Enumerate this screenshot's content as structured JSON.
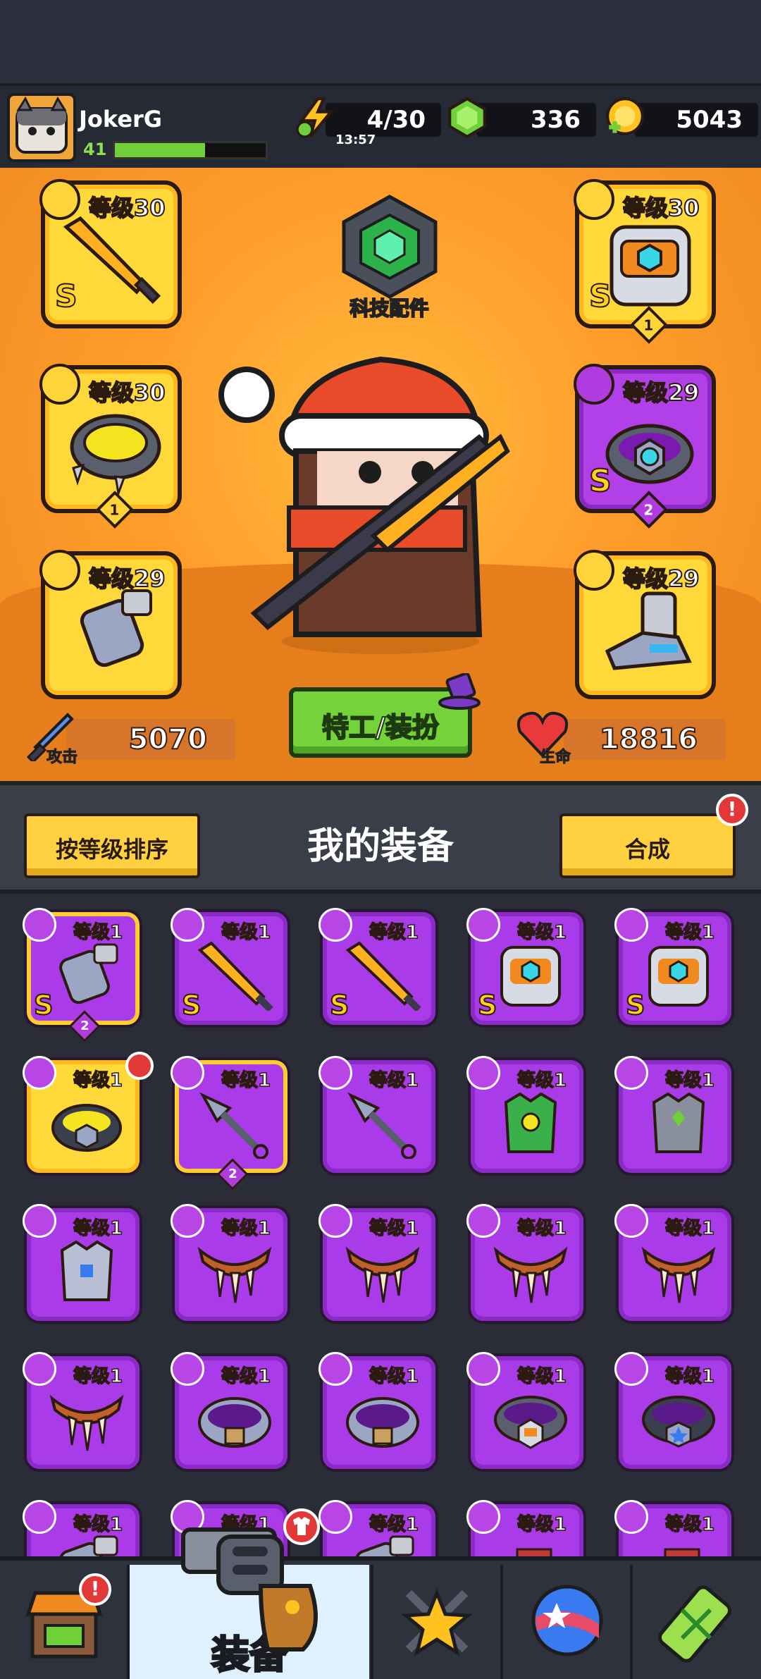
{
  "player": {
    "name": "JokerG",
    "level": "41",
    "xp_fraction": 0.6
  },
  "resources": [
    {
      "name": "energy",
      "icon": "lightning-icon",
      "value": "4/30",
      "sub": "13:57"
    },
    {
      "name": "gems",
      "icon": "green-gem-icon",
      "value": "336",
      "sub": ""
    },
    {
      "name": "coins",
      "icon": "gold-coin-icon",
      "value": "5043",
      "sub": ""
    }
  ],
  "tech": {
    "label": "科技配件"
  },
  "slots": {
    "weapon": {
      "level": "等级30",
      "rank": "S",
      "stars": ""
    },
    "armor": {
      "level": "等级30",
      "rank": "S",
      "stars": "1"
    },
    "necklace": {
      "level": "等级30",
      "rank": "",
      "stars": "1"
    },
    "belt": {
      "level": "等级29",
      "rank": "S",
      "stars": "2"
    },
    "gloves": {
      "level": "等级29",
      "rank": "",
      "stars": ""
    },
    "boots": {
      "level": "等级29",
      "rank": "",
      "stars": ""
    }
  },
  "stats": {
    "attack": {
      "label": "攻击",
      "value": "5070"
    },
    "health": {
      "label": "生命",
      "value": "18816"
    }
  },
  "agent_button": "特工/装扮",
  "section": {
    "sort_label": "按等级排序",
    "title": "我的装备",
    "merge_label": "合成",
    "merge_alert": "!"
  },
  "inventory": [
    {
      "level": "等级1",
      "rank": "S",
      "stars": "2",
      "kind": "gloves"
    },
    {
      "level": "等级1",
      "rank": "S",
      "stars": "",
      "kind": "sword"
    },
    {
      "level": "等级1",
      "rank": "S",
      "stars": "",
      "kind": "sword"
    },
    {
      "level": "等级1",
      "rank": "S",
      "stars": "",
      "kind": "armor"
    },
    {
      "level": "等级1",
      "rank": "S",
      "stars": "",
      "kind": "armor"
    },
    {
      "level": "等级1",
      "rank": "",
      "stars": "",
      "kind": "belt-gold"
    },
    {
      "level": "等级1",
      "rank": "",
      "stars": "2",
      "kind": "kunai"
    },
    {
      "level": "等级1",
      "rank": "",
      "stars": "",
      "kind": "kunai"
    },
    {
      "level": "等级1",
      "rank": "",
      "stars": "",
      "kind": "vest-green"
    },
    {
      "level": "等级1",
      "rank": "",
      "stars": "",
      "kind": "vest-grey"
    },
    {
      "level": "等级1",
      "rank": "",
      "stars": "",
      "kind": "vest-blue"
    },
    {
      "level": "等级1",
      "rank": "",
      "stars": "",
      "kind": "fang"
    },
    {
      "level": "等级1",
      "rank": "",
      "stars": "",
      "kind": "fang"
    },
    {
      "level": "等级1",
      "rank": "",
      "stars": "",
      "kind": "fang"
    },
    {
      "level": "等级1",
      "rank": "",
      "stars": "",
      "kind": "fang"
    },
    {
      "level": "等级1",
      "rank": "",
      "stars": "",
      "kind": "fang"
    },
    {
      "level": "等级1",
      "rank": "",
      "stars": "",
      "kind": "belt"
    },
    {
      "level": "等级1",
      "rank": "",
      "stars": "",
      "kind": "belt"
    },
    {
      "level": "等级1",
      "rank": "",
      "stars": "",
      "kind": "belt-hex"
    },
    {
      "level": "等级1",
      "rank": "",
      "stars": "",
      "kind": "belt-star"
    },
    {
      "level": "等级1",
      "rank": "",
      "stars": "",
      "kind": "gloves"
    },
    {
      "level": "等级1",
      "rank": "",
      "stars": "",
      "kind": "gloves"
    },
    {
      "level": "等级1",
      "rank": "",
      "stars": "",
      "kind": "gloves"
    },
    {
      "level": "等级1",
      "rank": "",
      "stars": "",
      "kind": "boots"
    },
    {
      "level": "等级1",
      "rank": "",
      "stars": "",
      "kind": "boots"
    }
  ],
  "nav": [
    {
      "name": "shop",
      "icon": "shop-icon",
      "label": "",
      "alert": "!"
    },
    {
      "name": "equipment",
      "icon": "revolver-icon",
      "label": "装备",
      "alert": ""
    },
    {
      "name": "battle",
      "icon": "crossed-swords-star-icon",
      "label": "",
      "alert": ""
    },
    {
      "name": "world",
      "icon": "planet-icon",
      "label": "",
      "alert": ""
    },
    {
      "name": "lab",
      "icon": "dna-battery-icon",
      "label": "",
      "alert": ""
    }
  ]
}
